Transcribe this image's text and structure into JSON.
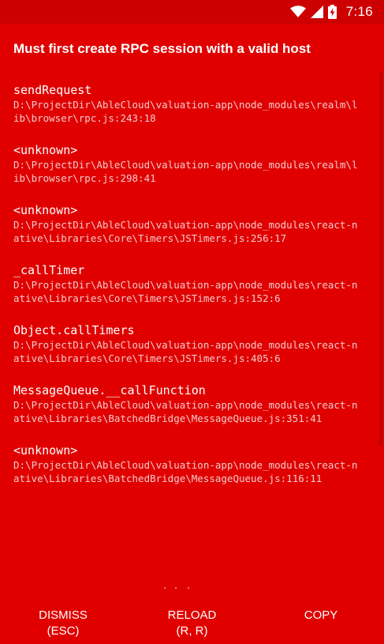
{
  "status_bar": {
    "time": "7:16",
    "icons": [
      "wifi-icon",
      "signal-icon",
      "battery-charging-icon"
    ]
  },
  "error": {
    "title": "Must first create RPC session with a valid host"
  },
  "stack": [
    {
      "method": "sendRequest",
      "file": "D:\\ProjectDir\\AbleCloud\\valuation-app\\node_modules\\realm\\lib\\browser\\rpc.js:243:18"
    },
    {
      "method": "<unknown>",
      "file": "D:\\ProjectDir\\AbleCloud\\valuation-app\\node_modules\\realm\\lib\\browser\\rpc.js:298:41"
    },
    {
      "method": "<unknown>",
      "file": "D:\\ProjectDir\\AbleCloud\\valuation-app\\node_modules\\react-native\\Libraries\\Core\\Timers\\JSTimers.js:256:17"
    },
    {
      "method": "_callTimer",
      "file": "D:\\ProjectDir\\AbleCloud\\valuation-app\\node_modules\\react-native\\Libraries\\Core\\Timers\\JSTimers.js:152:6"
    },
    {
      "method": "Object.callTimers",
      "file": "D:\\ProjectDir\\AbleCloud\\valuation-app\\node_modules\\react-native\\Libraries\\Core\\Timers\\JSTimers.js:405:6"
    },
    {
      "method": "MessageQueue.__callFunction",
      "file": "D:\\ProjectDir\\AbleCloud\\valuation-app\\node_modules\\react-native\\Libraries\\BatchedBridge\\MessageQueue.js:351:41"
    },
    {
      "method": "<unknown>",
      "file": "D:\\ProjectDir\\AbleCloud\\valuation-app\\node_modules\\react-native\\Libraries\\BatchedBridge\\MessageQueue.js:116:11"
    }
  ],
  "buttons": {
    "dismiss": {
      "label": "DISMISS",
      "shortcut": "(ESC)"
    },
    "reload": {
      "label": "RELOAD",
      "shortcut": "(R, R)"
    },
    "copy": {
      "label": "COPY",
      "shortcut": ""
    }
  },
  "colors": {
    "background": "#e00000",
    "status_bar": "#cc0000",
    "text": "#ffffff",
    "file_text": "#f6caca"
  }
}
